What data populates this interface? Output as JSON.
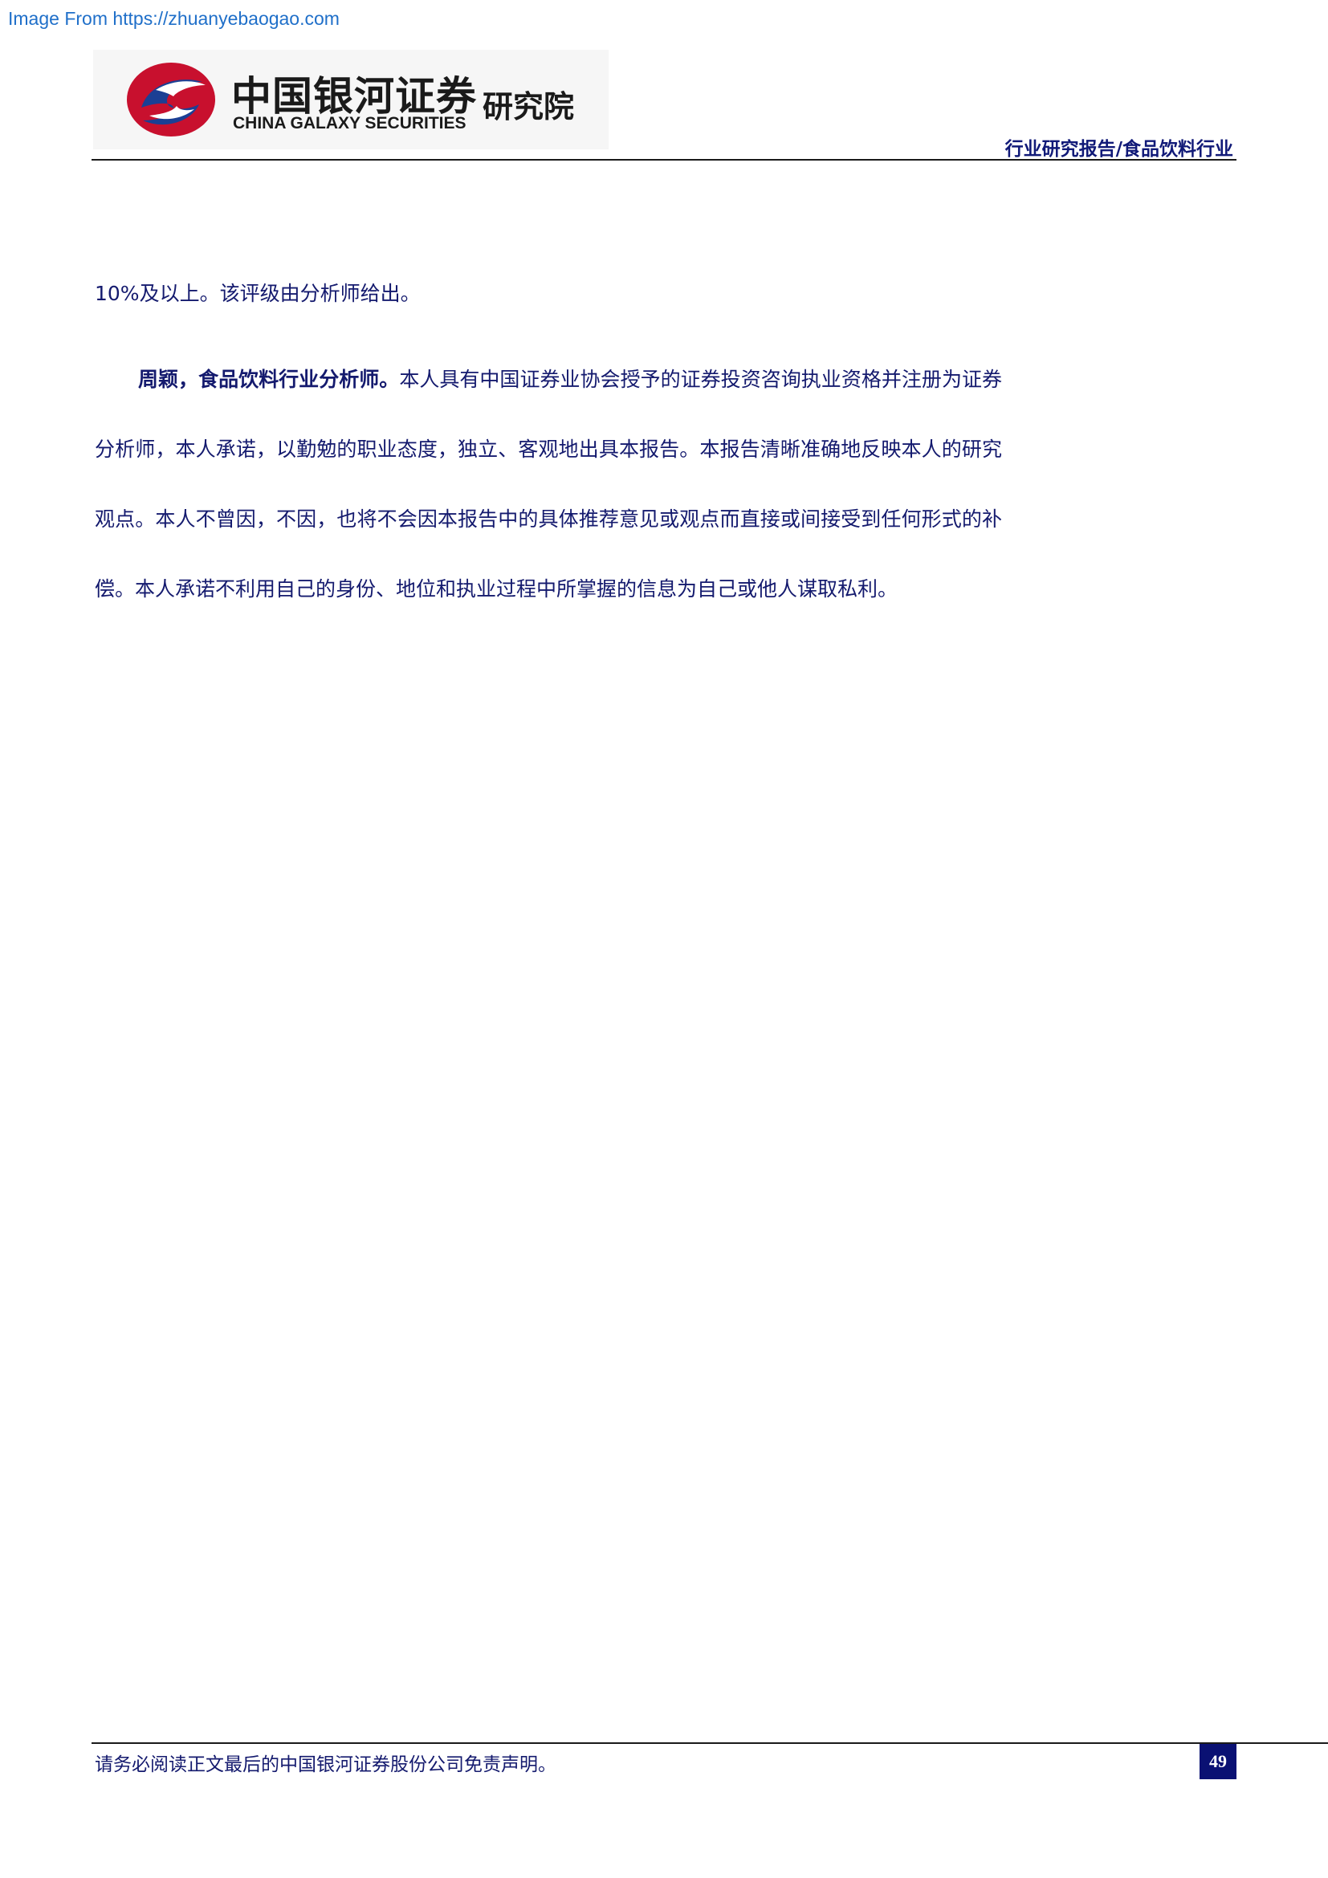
{
  "watermark": {
    "text": "Image From https://zhuanyebaogao.com"
  },
  "header": {
    "logo_cn": "中国银河证券",
    "logo_en": "CHINA GALAXY SECURITIES",
    "institute": "研究院",
    "category": "行业研究报告/食品饮料行业",
    "colors": {
      "logo_red": "#c8102e",
      "logo_blue": "#1b3f94",
      "text_navy": "#141a6e"
    }
  },
  "body": {
    "lead_line": "10%及以上。该评级由分析师给出。",
    "certification": {
      "analyst_label": "周颖，食品饮料行业分析师。",
      "statement": "本人具有中国证券业协会授予的证券投资咨询执业资格并注册为证券分析师，本人承诺，以勤勉的职业态度，独立、客观地出具本报告。本报告清晰准确地反映本人的研究观点。本人不曾因，不因，也将不会因本报告中的具体推荐意见或观点而直接或间接受到任何形式的补偿。本人承诺不利用自己的身份、地位和执业过程中所掌握的信息为自己或他人谋取私利。"
    }
  },
  "footer": {
    "disclaimer": "请务必阅读正文最后的中国银河证券股份公司免责声明。",
    "page_number": "49"
  }
}
